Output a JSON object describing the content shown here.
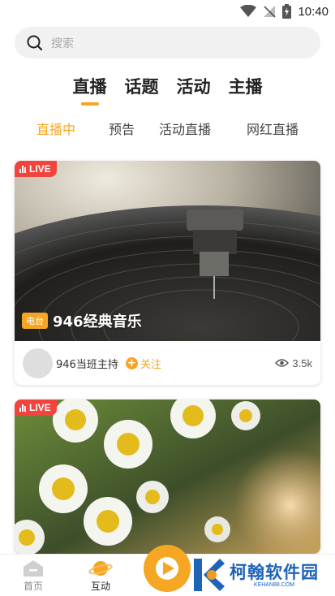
{
  "status_bar": {
    "time": "10:40"
  },
  "search": {
    "placeholder": "搜索"
  },
  "main_tabs": [
    {
      "label": "直播",
      "active": true
    },
    {
      "label": "话题",
      "active": false
    },
    {
      "label": "活动",
      "active": false
    },
    {
      "label": "主播",
      "active": false
    }
  ],
  "sub_tabs": [
    {
      "label": "直播中",
      "active": true
    },
    {
      "label": "预告",
      "active": false
    },
    {
      "label": "活动直播",
      "active": false
    },
    {
      "label": "网红直播",
      "active": false
    }
  ],
  "cards": [
    {
      "badge": "LIVE",
      "category": "电台",
      "title": "946经典音乐",
      "host": "946当班主持",
      "follow_label": "关注",
      "viewers": "3.5k"
    },
    {
      "badge": "LIVE"
    }
  ],
  "bottom_nav": [
    {
      "label": "首页",
      "icon": "home-icon",
      "active": false
    },
    {
      "label": "互动",
      "icon": "planet-icon",
      "active": true
    }
  ],
  "watermark": {
    "title": "柯翰软件园",
    "subtitle": "KEHAN88.COM"
  },
  "colors": {
    "accent": "#f5a623",
    "live": "#f0443d",
    "watermark": "#1d63b8"
  }
}
